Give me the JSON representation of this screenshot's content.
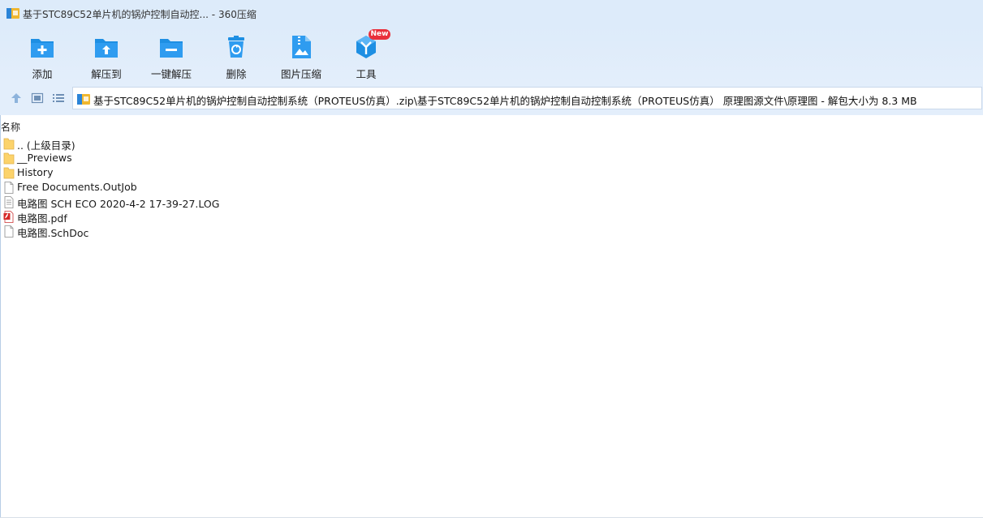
{
  "window": {
    "title": "基于STC89C52单片机的锅炉控制自动控... - 360压缩"
  },
  "toolbar": {
    "items": [
      {
        "label": "添加",
        "icon": "add-folder-icon"
      },
      {
        "label": "解压到",
        "icon": "extract-to-icon"
      },
      {
        "label": "一键解压",
        "icon": "one-click-extract-icon"
      },
      {
        "label": "删除",
        "icon": "trash-icon"
      },
      {
        "label": "图片压缩",
        "icon": "image-compress-icon"
      },
      {
        "label": "工具",
        "icon": "tools-icon",
        "badge": "New"
      }
    ]
  },
  "nav": {
    "up_icon": "arrow-up-icon",
    "thumbnail_icon": "thumbnail-view-icon",
    "list_icon": "list-view-icon"
  },
  "address": {
    "path": "基于STC89C52单片机的锅炉控制自动控制系统（PROTEUS仿真）.zip\\基于STC89C52单片机的锅炉控制自动控制系统（PROTEUS仿真） 原理图源文件\\原理图 - 解包大小为 8.3 MB"
  },
  "columns": {
    "name": "名称"
  },
  "files": [
    {
      "name": ".. (上级目录)",
      "type": "folder"
    },
    {
      "name": "__Previews",
      "type": "folder"
    },
    {
      "name": "History",
      "type": "folder"
    },
    {
      "name": "Free Documents.OutJob",
      "type": "file"
    },
    {
      "name": "电路图 SCH ECO 2020-4-2 17-39-27.LOG",
      "type": "file"
    },
    {
      "name": "电路图.pdf",
      "type": "pdf"
    },
    {
      "name": "电路图.SchDoc",
      "type": "file"
    }
  ],
  "colors": {
    "accent": "#1e8fe3",
    "toolbar_bg": "#ddebfa",
    "badge": "#e9303b",
    "folder": "#fcd36b"
  }
}
